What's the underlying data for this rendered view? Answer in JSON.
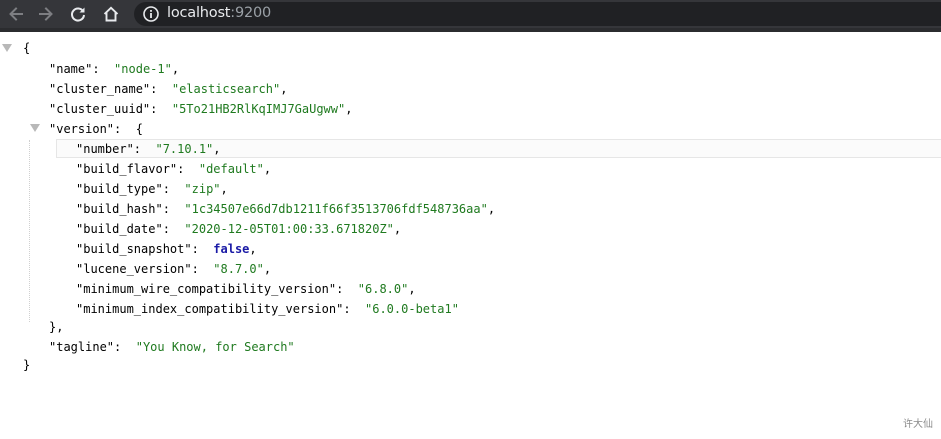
{
  "browser": {
    "url_host": "localhost",
    "url_port": ":9200",
    "icons": [
      "back-arrow-icon",
      "forward-arrow-icon",
      "reload-icon",
      "home-icon",
      "info-icon"
    ]
  },
  "json": {
    "open_brace": "{",
    "name_key": "\"name\"",
    "name_value": "\"node-1\"",
    "cluster_name_key": "\"cluster_name\"",
    "cluster_name_value": "\"elasticsearch\"",
    "cluster_uuid_key": "\"cluster_uuid\"",
    "cluster_uuid_value": "\"5To21HB2RlKqIMJ7GaUgww\"",
    "version_key": "\"version\"",
    "version_open": "{",
    "number_key": "\"number\"",
    "number_value": "\"7.10.1\"",
    "build_flavor_key": "\"build_flavor\"",
    "build_flavor_value": "\"default\"",
    "build_type_key": "\"build_type\"",
    "build_type_value": "\"zip\"",
    "build_hash_key": "\"build_hash\"",
    "build_hash_value": "\"1c34507e66d7db1211f66f3513706fdf548736aa\"",
    "build_date_key": "\"build_date\"",
    "build_date_value": "\"2020-12-05T01:00:33.671820Z\"",
    "build_snapshot_key": "\"build_snapshot\"",
    "build_snapshot_value": "false",
    "lucene_version_key": "\"lucene_version\"",
    "lucene_version_value": "\"8.7.0\"",
    "min_wire_key": "\"minimum_wire_compatibility_version\"",
    "min_wire_value": "\"6.8.0\"",
    "min_index_key": "\"minimum_index_compatibility_version\"",
    "min_index_value": "\"6.0.0-beta1\"",
    "version_close": "},",
    "tagline_key": "\"tagline\"",
    "tagline_value": "\"You Know, for Search\"",
    "close_brace": "}"
  },
  "watermark": "许大仙"
}
